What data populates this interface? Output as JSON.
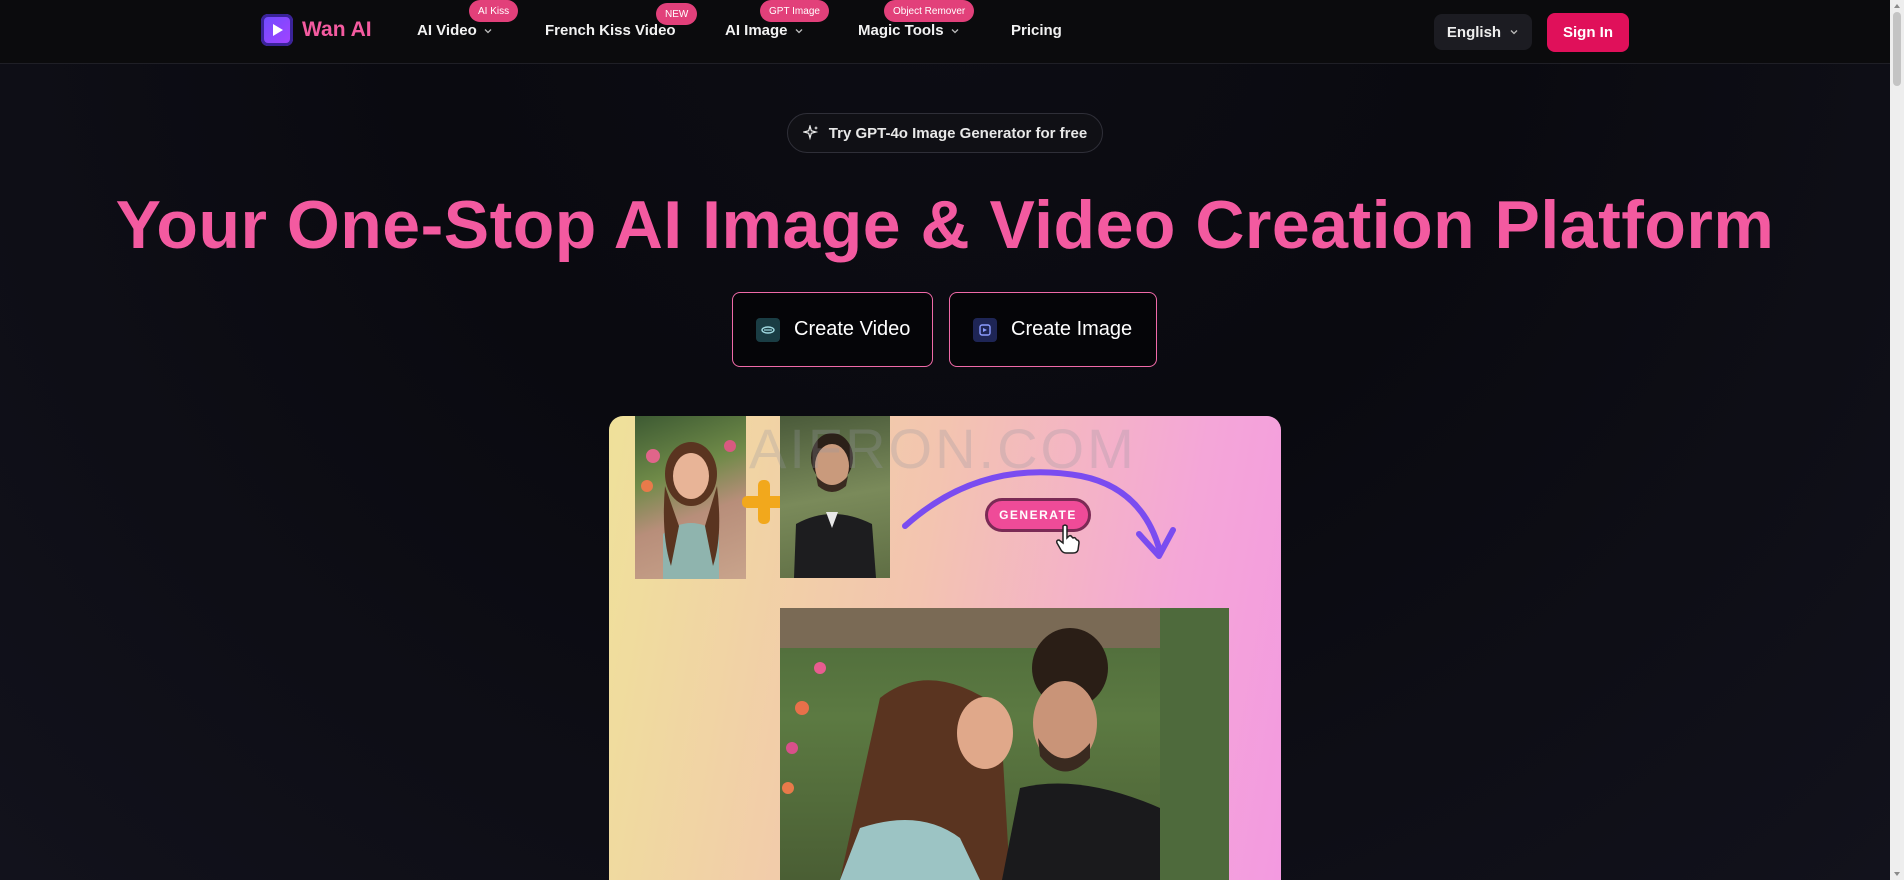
{
  "header": {
    "logo_text": "Wan AI",
    "nav": [
      {
        "label": "AI Video",
        "badge": "AI Kiss",
        "has_dropdown": true
      },
      {
        "label": "French Kiss Video",
        "badge": "NEW",
        "has_dropdown": false
      },
      {
        "label": "AI Image",
        "badge": "GPT Image",
        "has_dropdown": true
      },
      {
        "label": "Magic Tools",
        "badge": "Object Remover",
        "has_dropdown": true
      },
      {
        "label": "Pricing",
        "badge": "",
        "has_dropdown": false
      }
    ],
    "language": "English",
    "signin_label": "Sign In"
  },
  "hero": {
    "pill_text": "Try GPT-4o Image Generator for free",
    "title": "Your One-Stop AI Image & Video Creation Platform",
    "cta_video": "Create Video",
    "cta_image": "Create Image"
  },
  "showcase": {
    "watermark": "AIFRON.COM",
    "generate_label": "GENERATE"
  },
  "colors": {
    "accent_pink": "#f35aa0",
    "signin_bg": "#e0105a",
    "badge_bg": "#e2407a"
  }
}
